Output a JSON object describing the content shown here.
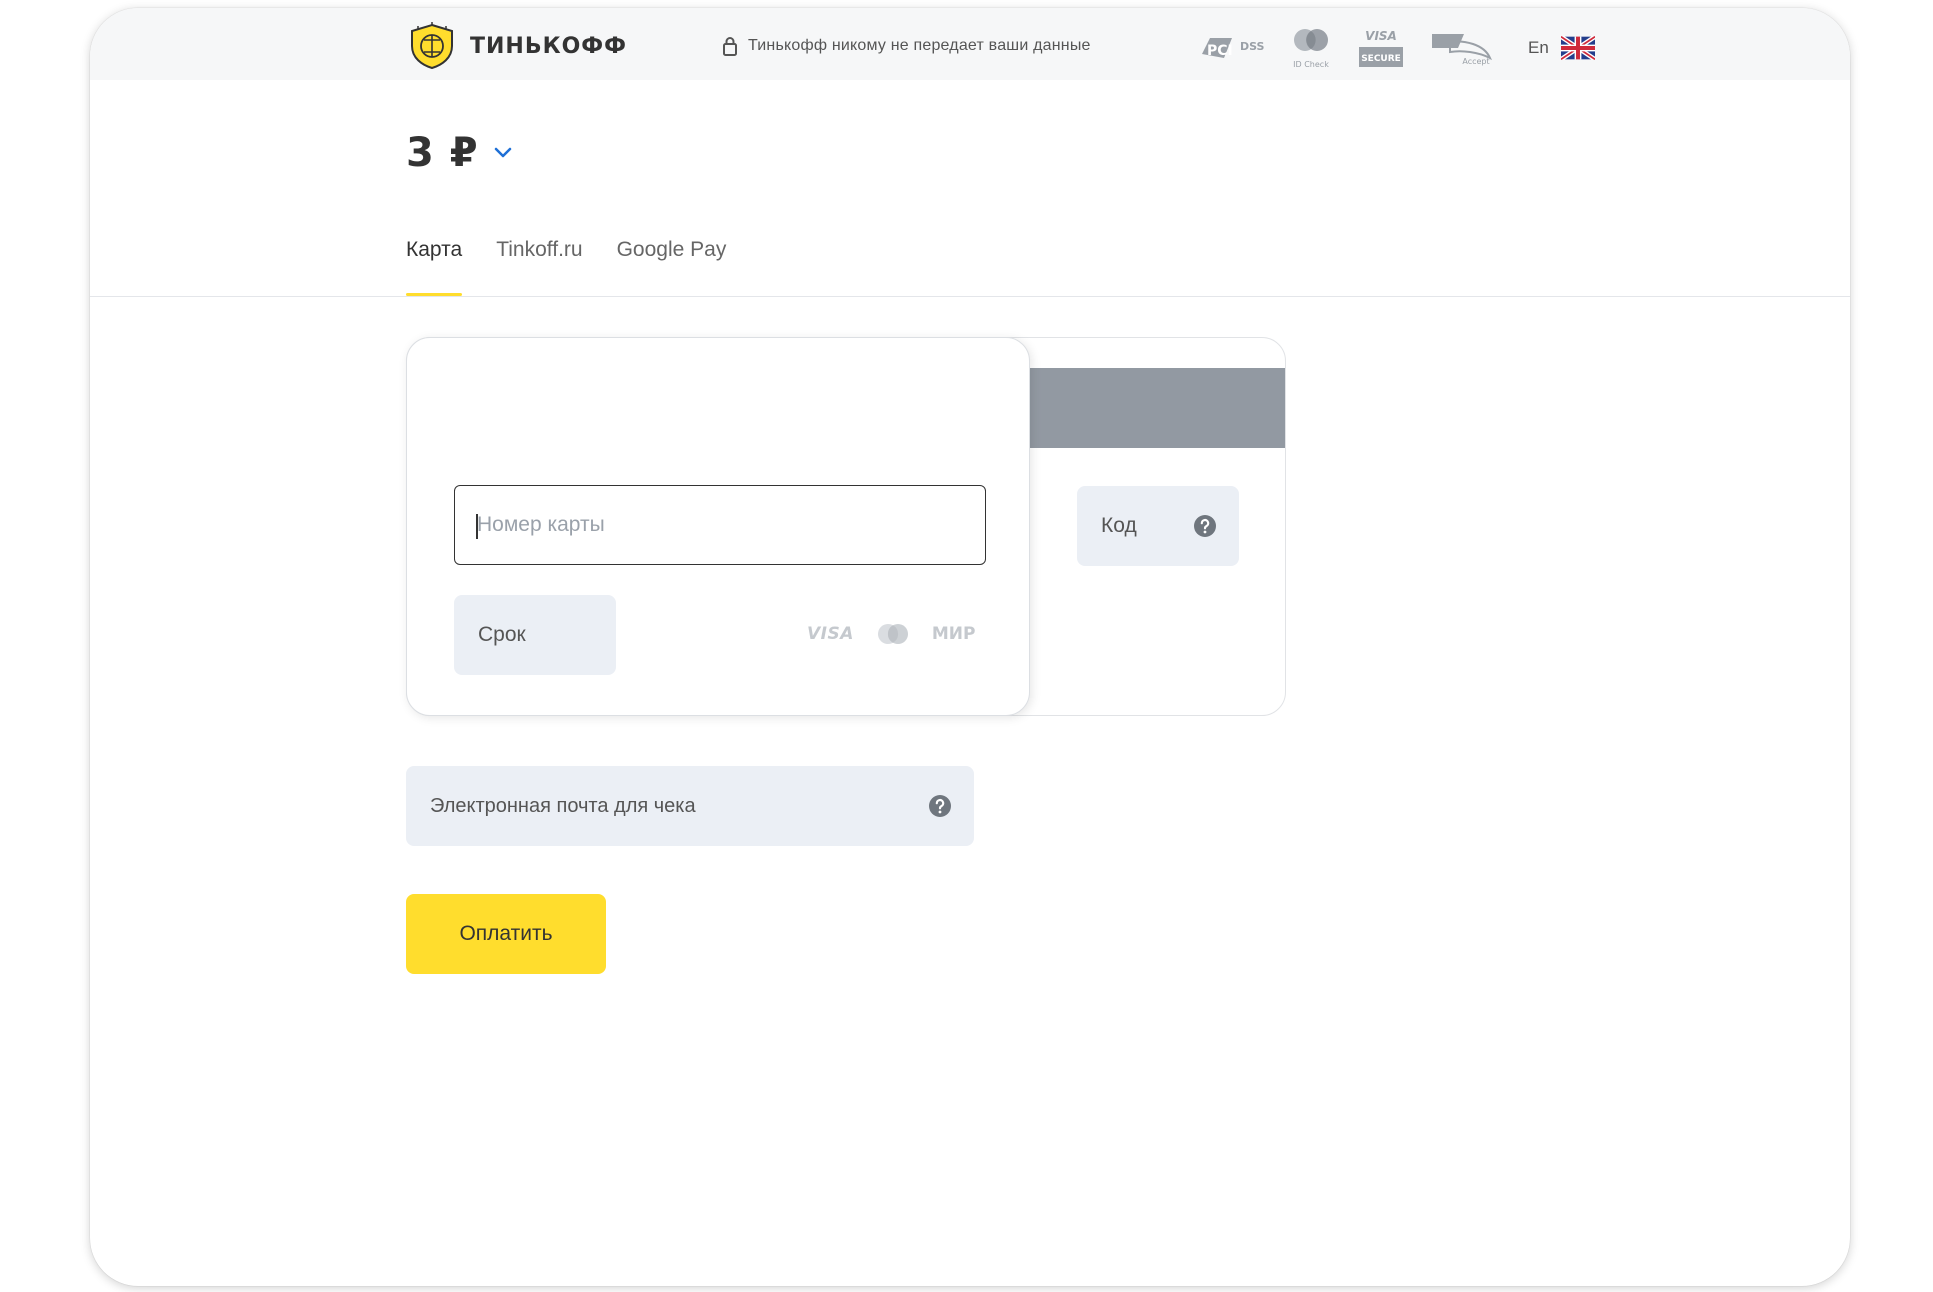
{
  "header": {
    "brand_name": "ТИНЬКОФФ",
    "secure_note": "Тинькофф никому не передает ваши данные",
    "badges": {
      "pci_text": "DSS",
      "mastercard_caption": "ID Check",
      "visa_text": "VISA",
      "visa_secure": "SECURE",
      "mir_caption": "Accept"
    },
    "language": "En"
  },
  "payment": {
    "amount": "3 ₽"
  },
  "tabs": [
    {
      "label": "Карта",
      "active": true
    },
    {
      "label": "Tinkoff.ru",
      "active": false
    },
    {
      "label": "Google Pay",
      "active": false
    }
  ],
  "card_form": {
    "card_number_placeholder": "Номер карты",
    "card_number_value": "",
    "expiry_placeholder": "Срок",
    "cvc_placeholder": "Код",
    "payment_systems": {
      "visa": "VISA",
      "mir": "МИР"
    }
  },
  "email": {
    "placeholder": "Электронная почта для чека"
  },
  "actions": {
    "pay_label": "Оплатить"
  },
  "colors": {
    "accent_yellow": "#ffdd2d",
    "field_background": "#ebeff5",
    "magnetic_stripe": "#9299a2",
    "header_background": "#f6f7f8"
  }
}
